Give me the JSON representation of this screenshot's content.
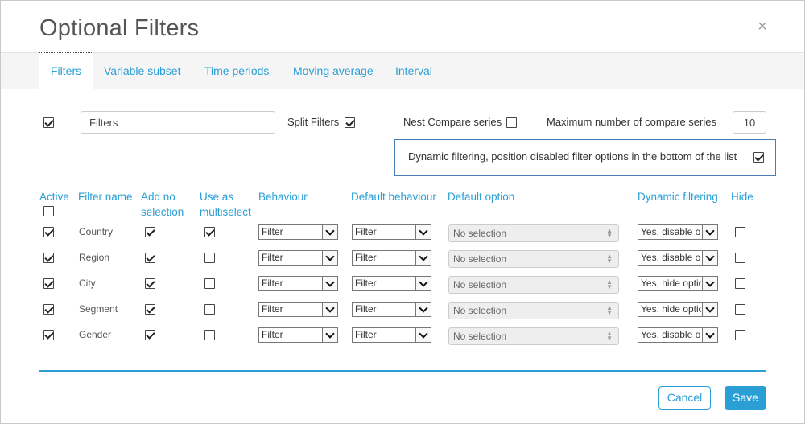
{
  "dialog": {
    "title": "Optional Filters",
    "close_glyph": "×"
  },
  "tabs": [
    {
      "label": "Filters",
      "active": true
    },
    {
      "label": "Variable subset",
      "active": false
    },
    {
      "label": "Time periods",
      "active": false
    },
    {
      "label": "Moving average",
      "active": false
    },
    {
      "label": "Interval",
      "active": false
    }
  ],
  "options": {
    "filters_enabled": true,
    "filters_input_value": "Filters",
    "split_filters_label": "Split Filters",
    "split_filters_checked": true,
    "nest_compare_label": "Nest Compare series",
    "nest_compare_checked": false,
    "max_compare_label": "Maximum number of compare series",
    "max_compare_value": "10",
    "dynamic_filtering_label": "Dynamic filtering, position disabled filter options in the bottom of the list",
    "dynamic_filtering_checked": true
  },
  "table": {
    "headers": {
      "active": "Active",
      "filter_name": "Filter name",
      "add_no_1": "Add no",
      "add_no_2": "selection",
      "multi_1": "Use as",
      "multi_2": "multiselect",
      "behaviour": "Behaviour",
      "default_behaviour": "Default behaviour",
      "default_option": "Default option",
      "dynamic_filtering": "Dynamic filtering",
      "hide": "Hide"
    },
    "select_all_active": false,
    "rows": [
      {
        "name": "Country",
        "active": true,
        "add_no_selection": true,
        "multiselect": true,
        "behaviour": "Filter",
        "default_behaviour": "Filter",
        "default_option": "No selection",
        "dynamic": "Yes, disable options",
        "hide": false
      },
      {
        "name": "Region",
        "active": true,
        "add_no_selection": true,
        "multiselect": false,
        "behaviour": "Filter",
        "default_behaviour": "Filter",
        "default_option": "No selection",
        "dynamic": "Yes, disable options",
        "hide": false
      },
      {
        "name": "City",
        "active": true,
        "add_no_selection": true,
        "multiselect": false,
        "behaviour": "Filter",
        "default_behaviour": "Filter",
        "default_option": "No selection",
        "dynamic": "Yes, hide options",
        "hide": false
      },
      {
        "name": "Segment",
        "active": true,
        "add_no_selection": true,
        "multiselect": false,
        "behaviour": "Filter",
        "default_behaviour": "Filter",
        "default_option": "No selection",
        "dynamic": "Yes, hide options",
        "hide": false
      },
      {
        "name": "Gender",
        "active": true,
        "add_no_selection": true,
        "multiselect": false,
        "behaviour": "Filter",
        "default_behaviour": "Filter",
        "default_option": "No selection",
        "dynamic": "Yes, disable options",
        "hide": false
      }
    ]
  },
  "footer": {
    "cancel_label": "Cancel",
    "save_label": "Save"
  },
  "colors": {
    "accent": "#2a9fd6",
    "dynamic_box_border": "#4a7fb5"
  }
}
